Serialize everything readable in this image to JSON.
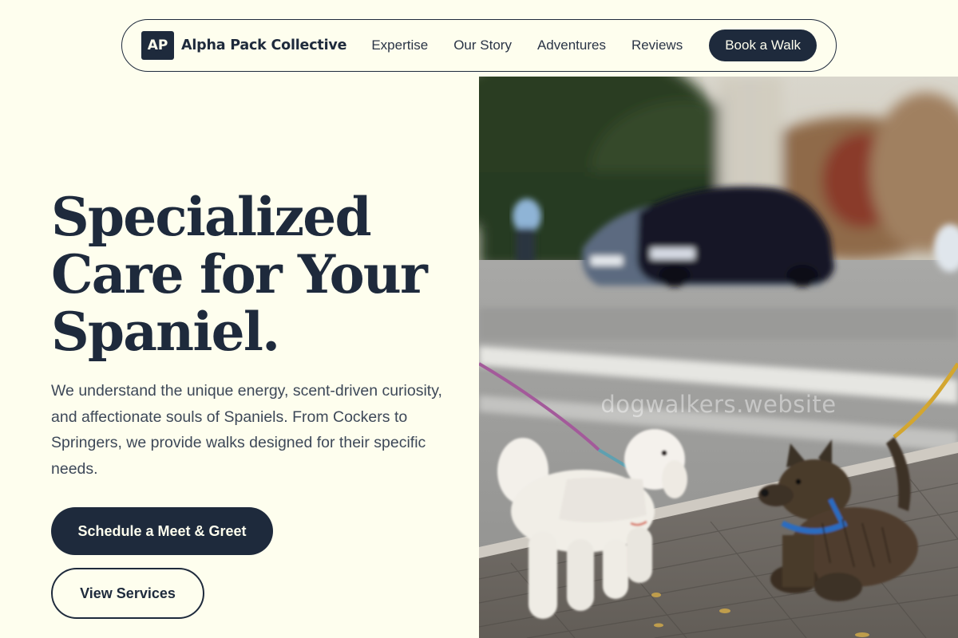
{
  "nav": {
    "logo_initials": "AP",
    "brand_name": "Alpha Pack Collective",
    "links": [
      "Expertise",
      "Our Story",
      "Adventures",
      "Reviews"
    ],
    "cta_label": "Book a Walk"
  },
  "hero": {
    "title_lines": [
      "Specialized",
      "Care for Your",
      "Spaniel."
    ],
    "description": "We understand the unique energy, scent-driven curiosity, and affectionate souls of Spaniels. From Cockers to Springers, we provide walks designed for their specific needs.",
    "primary_button": "Schedule a Meet & Greet",
    "secondary_button": "View Services",
    "image_watermark": "dogwalkers.website"
  },
  "colors": {
    "background": "#fefeee",
    "ink": "#1e2a3c",
    "body_text": "#3d4858"
  }
}
